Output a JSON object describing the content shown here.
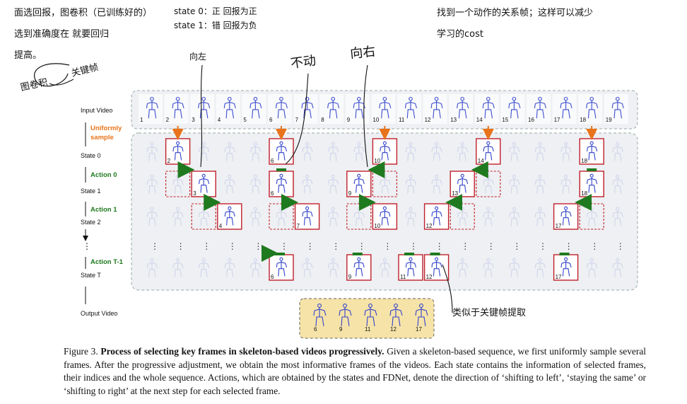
{
  "handwritten": {
    "note_top_left_1": "面选回报，图卷积（已训练好的）",
    "note_top_left_2": "选到准确度在 就要回归",
    "note_top_left_3": "提高。",
    "note_state": "state 0：正  回报为正",
    "note_state_2": "state 1：错  回报为负",
    "note_top_right_1": "找到一个动作的关系帧；这样可以减少",
    "note_top_right_2": "学习的cost",
    "note_graph": "图卷积",
    "note_keyframe": "关键帧",
    "note_left": "向左",
    "note_stay": "不动",
    "note_right": "向右",
    "note_similar": "类似于关键帧提取"
  },
  "figure": {
    "row_labels": {
      "input_video": "Input Video",
      "uniform_sample_1": "Uniformly",
      "uniform_sample_2": "sample",
      "state0": "State 0",
      "action0": "Action 0",
      "state1": "State 1",
      "action1": "Action 1",
      "state2": "State 2",
      "dots": "⋮",
      "action_t1": "Action T-1",
      "state_t": "State T",
      "output_video": "Output Video"
    },
    "input_frames": [
      "1",
      "2",
      "3",
      "4",
      "5",
      "6",
      "7",
      "8",
      "9",
      "10",
      "11",
      "12",
      "13",
      "14",
      "15",
      "16",
      "17",
      "18",
      "19"
    ],
    "state0_selected": [
      "2",
      "6",
      "10",
      "14",
      "18"
    ],
    "state1_selected": [
      "3",
      "6",
      "9",
      "13",
      "18"
    ],
    "state2_selected": [
      "4",
      "7",
      "10",
      "12",
      "17"
    ],
    "stateT_selected": [
      "6",
      "9",
      "11",
      "12",
      "17"
    ],
    "output_frames": [
      "6",
      "9",
      "11",
      "12",
      "17"
    ],
    "colors": {
      "accent_orange": "#e8731a",
      "action_green": "#1f7a1f",
      "frame_red": "#c0202a",
      "skeleton_blue": "#3344cc",
      "panel_bg": "#eef0f3",
      "output_bg": "#f6e3a8"
    }
  },
  "caption": {
    "label": "Figure 3.",
    "title": "Process of selecting key frames in skeleton-based videos progressively.",
    "body": "Given a skeleton-based sequence, we first uniformly sample several frames. After the progressive adjustment, we obtain the most informative frames of the videos. Each state contains the information of selected frames, their indices and the whole sequence. Actions, which are obtained by the states and FDNet, denote the direction of ‘shifting to left’, ‘staying the same’ or ‘shifting to right’ at the next step for each selected frame."
  }
}
